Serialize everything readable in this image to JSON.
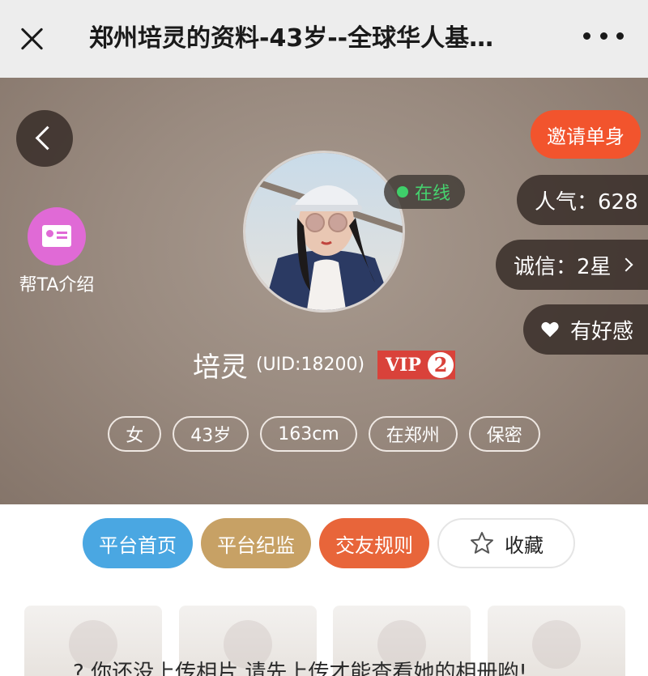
{
  "topbar": {
    "title": "郑州培灵的资料-43岁--全球华人基…"
  },
  "hero": {
    "intro_label": "帮TA介绍",
    "online_label": "在线",
    "invite_label": "邀请单身",
    "popularity_label": "人气：628",
    "integrity_label": "诚信：2星",
    "favor_label": "有好感",
    "name": "培灵",
    "uid": "(UID:18200)",
    "vip_text": "VIP",
    "vip_level": "2",
    "tags": [
      "女",
      "43岁",
      "163cm",
      "在郑州",
      "保密"
    ]
  },
  "actions": {
    "home": "平台首页",
    "supervise": "平台纪监",
    "rules": "交友规则",
    "favorite": "收藏"
  },
  "photos": {
    "note": "? 你还没上传相片,请先上传才能查看她的相册哟!"
  },
  "colors": {
    "invite": "#f2542d",
    "home": "#4aa7e2",
    "supervise": "#c7a165",
    "rules": "#e8653a",
    "intro": "#e06ad6",
    "vip": "#d9423a",
    "online": "#3fcf6a"
  }
}
